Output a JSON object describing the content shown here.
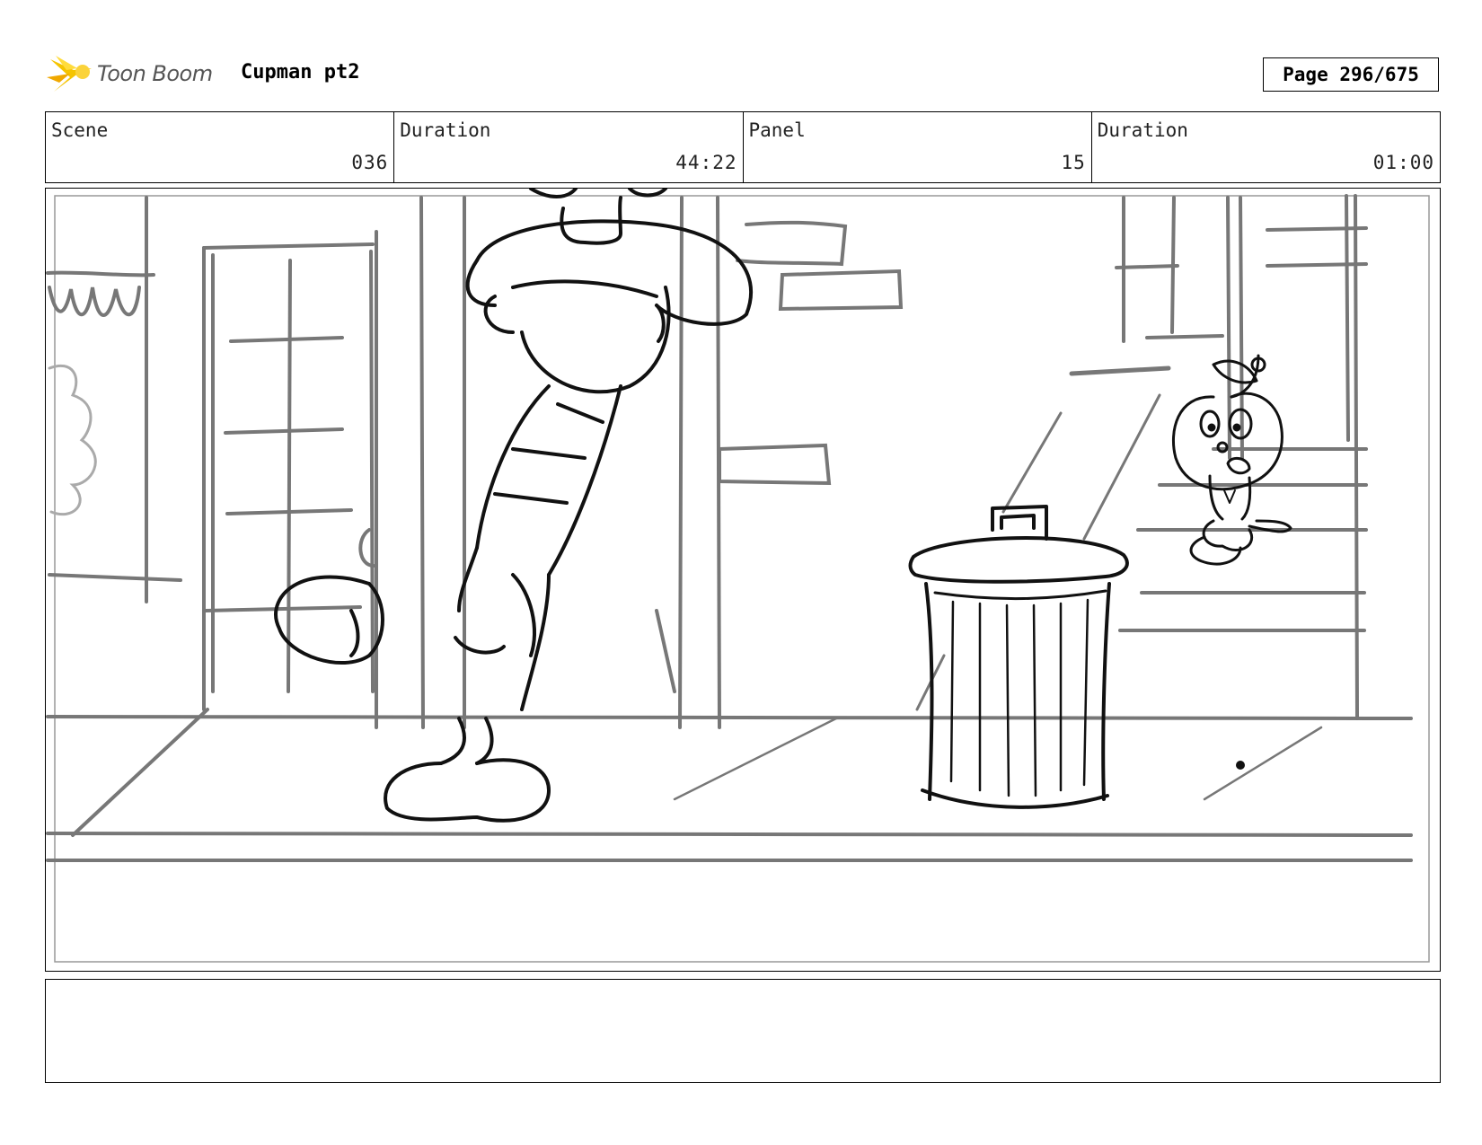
{
  "header": {
    "brand": "Toon Boom",
    "project_title": "Cupman pt2",
    "page_label": "Page 296/675"
  },
  "info": {
    "scene_label": "Scene",
    "scene_value": "036",
    "scene_duration_label": "Duration",
    "scene_duration_value": "44:22",
    "panel_label": "Panel",
    "panel_value": "15",
    "panel_duration_label": "Duration",
    "panel_duration_value": "01:00"
  },
  "notes": {
    "text": ""
  },
  "colors": {
    "logo_yellow": "#f5c400",
    "sketch_dark": "#111111",
    "sketch_gray": "#777777"
  }
}
